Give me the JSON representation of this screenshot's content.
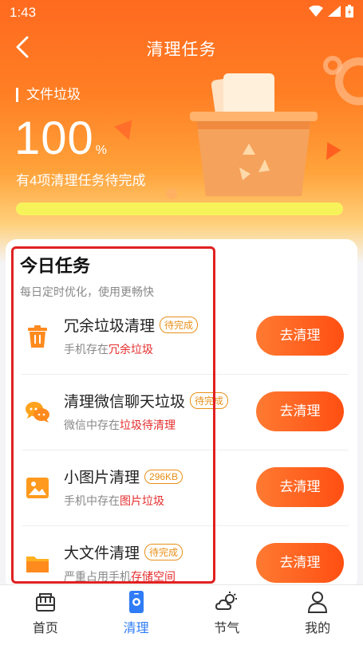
{
  "status_bar": {
    "time": "1:43"
  },
  "header": {
    "title": "清理任务"
  },
  "summary": {
    "label": "文件垃圾",
    "value": "100",
    "unit": "%",
    "subtitle": "有4项清理任务待完成",
    "progress": 1.0
  },
  "tasks_card": {
    "title": "今日任务",
    "subtitle": "每日定时优化，使用更畅快",
    "tasks": [
      {
        "name": "冗余垃圾清理",
        "badge": "待完成",
        "desc_prefix": "手机存在",
        "desc_highlight": "冗余垃圾",
        "button": "去清理",
        "icon": "trash-can-icon"
      },
      {
        "name": "清理微信聊天垃圾",
        "badge": "待完成",
        "desc_prefix": "微信中存在",
        "desc_highlight": "垃圾待清理",
        "button": "去清理",
        "icon": "chat-bubbles-icon"
      },
      {
        "name": "小图片清理",
        "badge": "296KB",
        "desc_prefix": "手机中存在",
        "desc_highlight": "图片垃圾",
        "button": "去清理",
        "icon": "image-icon"
      },
      {
        "name": "大文件清理",
        "badge": "待完成",
        "desc_prefix": "严重占用手机",
        "desc_highlight": "存储空间",
        "button": "去清理",
        "icon": "folder-icon"
      }
    ]
  },
  "tab_bar": {
    "items": [
      {
        "label": "首页",
        "icon": "home-icon",
        "active": false
      },
      {
        "label": "清理",
        "icon": "phone-clean-icon",
        "active": true
      },
      {
        "label": "节气",
        "icon": "weather-icon",
        "active": false
      },
      {
        "label": "我的",
        "icon": "profile-icon",
        "active": false
      }
    ]
  },
  "colors": {
    "accent": "#ff5a1a",
    "active_tab": "#2f7cf6",
    "highlight_text": "#e52d2d",
    "badge": "#e8901a"
  }
}
